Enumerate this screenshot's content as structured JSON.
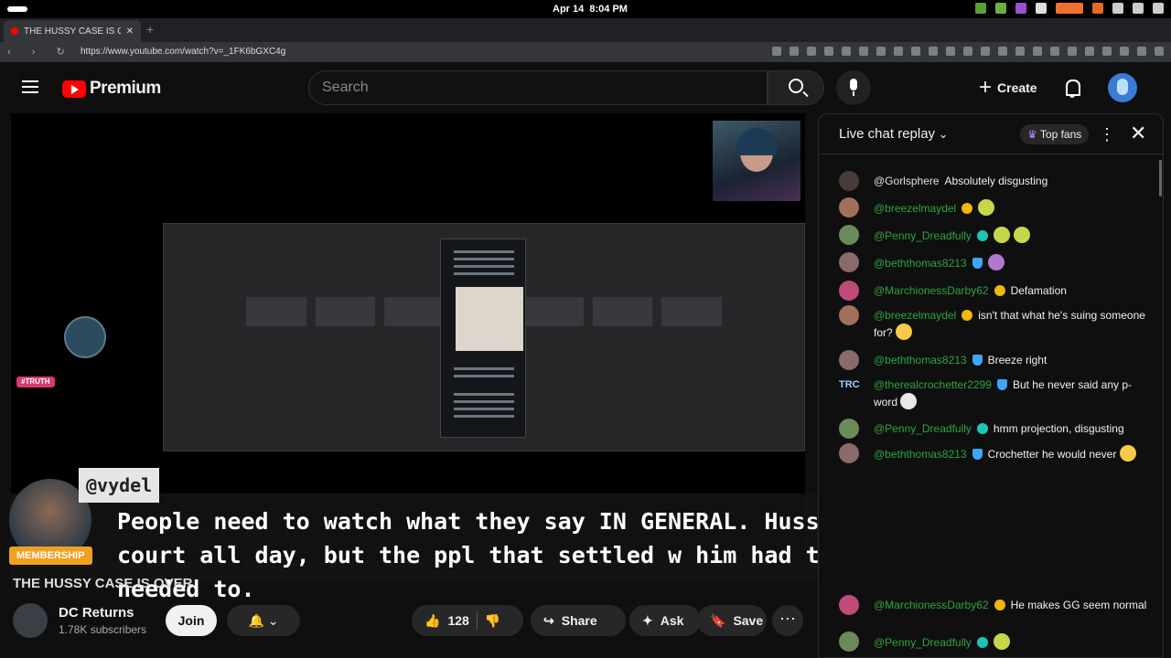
{
  "os": {
    "date": "Apr 14",
    "time": "8:04 PM"
  },
  "browser": {
    "tab_title": "THE HUSSY CASE IS OV",
    "new_tab": "+",
    "nav_glyphs": "‹ › ↻",
    "url": "https://www.youtube.com/watch?v=_1FK6bGXC4g"
  },
  "youtube": {
    "brand": "Premium",
    "search_placeholder": "Search",
    "create_label": "Create",
    "plus_glyph": "+"
  },
  "video": {
    "tag": "#TRUTH",
    "caption_handle": "@vydel",
    "caption_text": "People need to watch what they say IN GENERAL. Hussy can try to take ppl to court all day, but the ppl that settled w him had to bc they felt they needed to.",
    "membership_label": "MEMBERSHIP",
    "title": "THE HUSSY CASE IS OVER"
  },
  "channel": {
    "name": "DC Returns",
    "subscribers": "1.78K subscribers",
    "join_label": "Join",
    "bell_glyph": "🔔 ⌄",
    "like_count": "128",
    "like_glyph": "👍",
    "dislike_glyph": "👎",
    "share_label": "Share",
    "share_glyph": "↪",
    "ask_label": "Ask",
    "ask_glyph": "✦",
    "save_label": "Save",
    "save_glyph": "🔖",
    "more_glyph": "⋯"
  },
  "chat": {
    "title": "Live chat replay",
    "top_fans": "Top fans",
    "crown_glyph": "♛",
    "kebab_glyph": "⋮",
    "close_glyph": "✕",
    "trc_logo": "TRC",
    "messages": [
      {
        "user": "@Gorlsphere",
        "text": "Absolutely disgusting"
      },
      {
        "user": "@breezelmaydel",
        "text": ""
      },
      {
        "user": "@Penny_Dreadfully",
        "text": ""
      },
      {
        "user": "@beththomas8213",
        "text": ""
      },
      {
        "user": "@MarchionessDarby62",
        "text": "Defamation"
      },
      {
        "user": "@breezelmaydel",
        "text": "isn't that what he's suing someone for?"
      },
      {
        "user": "@beththomas8213",
        "text": "Breeze right"
      },
      {
        "user": "@therealcrochetter2299",
        "text": "But he never said any p-word"
      },
      {
        "user": "@Penny_Dreadfully",
        "text": "hmm projection, disgusting"
      },
      {
        "user": "@beththomas8213",
        "text": "Crochetter he would never"
      },
      {
        "user": "@MarchionessDarby62",
        "text": "He makes GG seem normal"
      },
      {
        "user": "@Penny_Dreadfully",
        "text": ""
      }
    ]
  },
  "colors": {
    "youtube_red": "#ff0000",
    "chat_user": "#2ba640",
    "membership": "#f0a020"
  }
}
